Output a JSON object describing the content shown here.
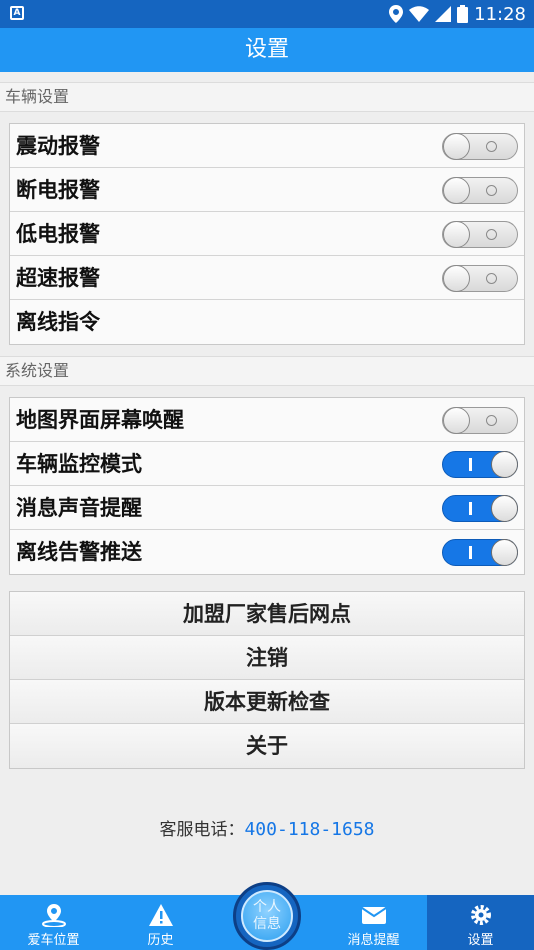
{
  "statusbar": {
    "notif": "A",
    "time": "11:28"
  },
  "appbar": {
    "title": "设置"
  },
  "vehicle_section": {
    "header": "车辆设置",
    "rows": [
      {
        "label": "震动报警",
        "toggle": "off"
      },
      {
        "label": "断电报警",
        "toggle": "off"
      },
      {
        "label": "低电报警",
        "toggle": "off"
      },
      {
        "label": "超速报警",
        "toggle": "off"
      },
      {
        "label": "离线指令",
        "toggle": "none"
      }
    ]
  },
  "system_section": {
    "header": "系统设置",
    "rows": [
      {
        "label": "地图界面屏幕唤醒",
        "toggle": "off"
      },
      {
        "label": "车辆监控模式",
        "toggle": "on"
      },
      {
        "label": "消息声音提醒",
        "toggle": "on"
      },
      {
        "label": "离线告警推送",
        "toggle": "on"
      }
    ]
  },
  "buttons": [
    "加盟厂家售后网点",
    "注销",
    "版本更新检查",
    "关于"
  ],
  "hotline": {
    "label": "客服电话：",
    "number": "400-118-1658"
  },
  "tabs": [
    {
      "label": "爱车位置",
      "icon": "location-pin-icon"
    },
    {
      "label": "历史",
      "icon": "warning-icon"
    },
    {
      "label": "个人信息",
      "icon": "profile-circle-icon"
    },
    {
      "label": "消息提醒",
      "icon": "mail-icon"
    },
    {
      "label": "设置",
      "icon": "gear-icon",
      "active": true
    }
  ],
  "center_button": {
    "line1": "个人",
    "line2": "信息"
  },
  "colors": {
    "primary": "#2196f3",
    "primary_dark": "#1565c0",
    "toggle_on": "#1677e6"
  }
}
